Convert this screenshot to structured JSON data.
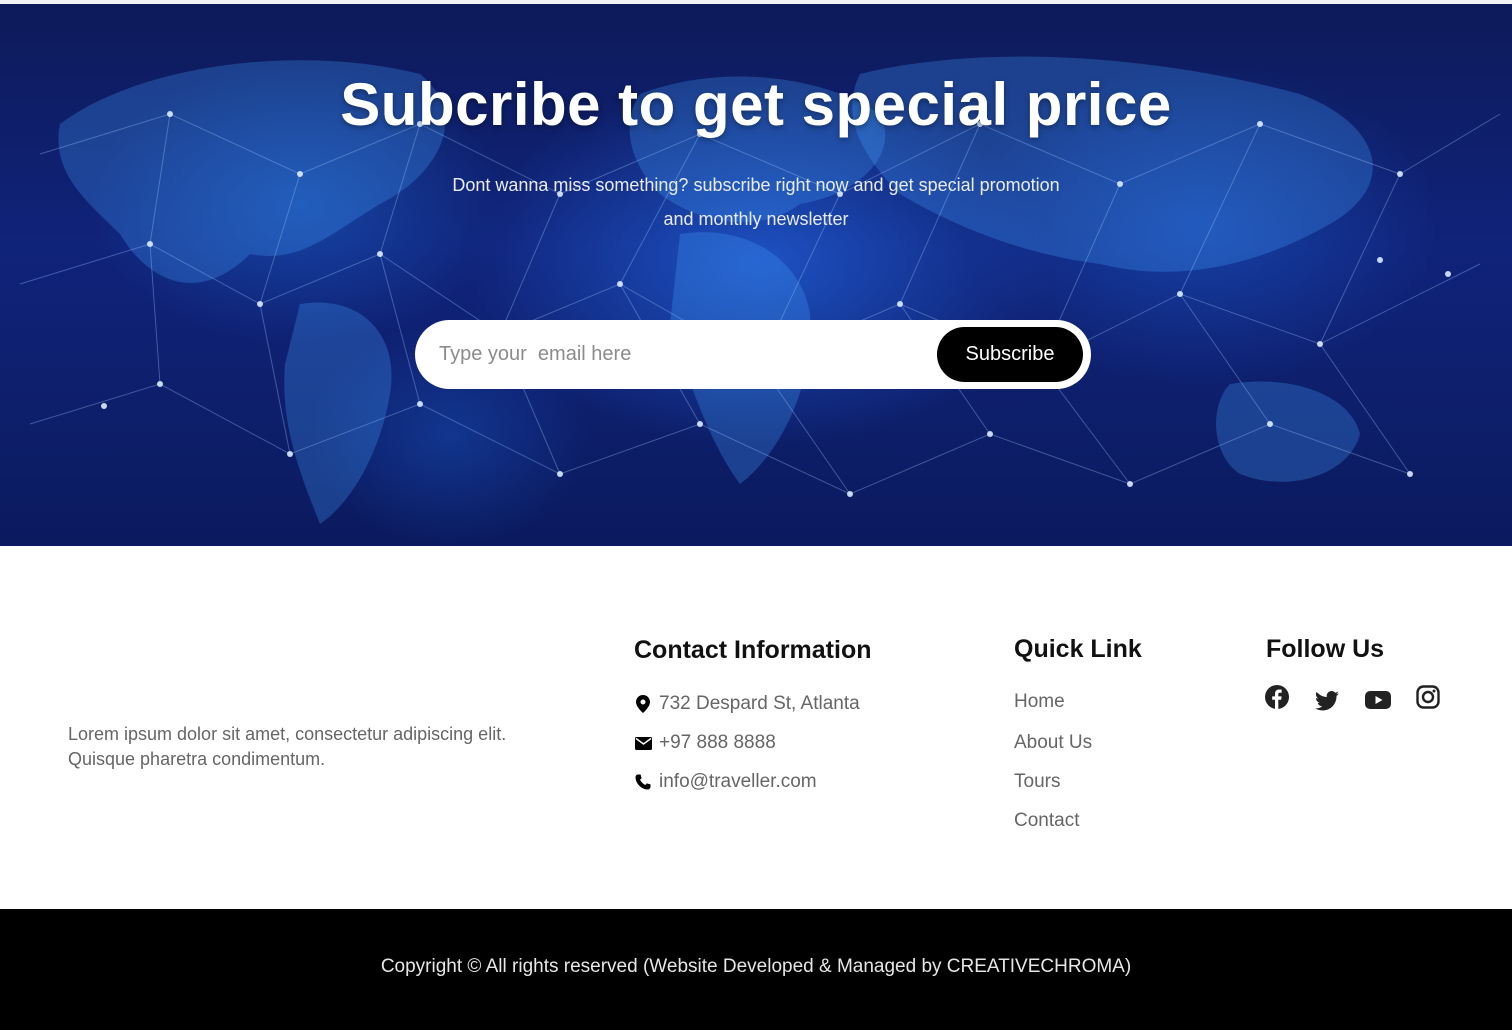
{
  "hero": {
    "title": "Subcribe to get special price",
    "subtitle": "Dont wanna miss something? subscribe right now and get special promotion and monthly newsletter",
    "email_placeholder": "Type your  email here",
    "subscribe_label": "Subscribe",
    "background_icon": "world-map-network-image"
  },
  "about": {
    "text": "Lorem ipsum dolor sit amet, consectetur adipiscing elit. Quisque pharetra condimentum."
  },
  "contact": {
    "heading": "Contact Information",
    "items": [
      {
        "icon": "map-pin-icon",
        "text": "732 Despard St, Atlanta"
      },
      {
        "icon": "envelope-icon",
        "text": "+97 888 8888"
      },
      {
        "icon": "phone-icon",
        "text": "info@traveller.com"
      }
    ]
  },
  "quick_links": {
    "heading": "Quick Link",
    "items": [
      "Home",
      "About Us",
      "Tours",
      "Contact"
    ]
  },
  "follow": {
    "heading": "Follow Us",
    "icons": [
      "facebook-icon",
      "twitter-icon",
      "youtube-icon",
      "instagram-icon"
    ]
  },
  "footer": {
    "copyright": "Copyright © All rights reserved (Website Developed & Managed by CREATIVECHROMA)"
  },
  "colors": {
    "hero_bg": "#10237a",
    "button_bg": "#000000",
    "text_gray": "#666666",
    "heading": "#111111",
    "copyright_bg": "#000000"
  }
}
